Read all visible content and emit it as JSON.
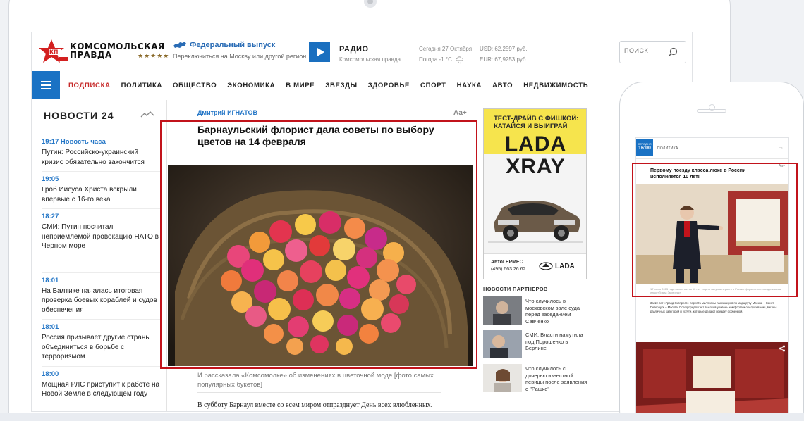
{
  "logo": {
    "line1": "КОМСОМОЛЬСКАЯ",
    "line2": "ПРАВДА",
    "orders": "★★★★★"
  },
  "edition": {
    "title": "Федеральный выпуск",
    "subtitle": "Переключиться на Москву или другой регион"
  },
  "radio": {
    "title": "РАДИО",
    "subtitle": "Комсомольская правда"
  },
  "date": {
    "today": "Сегодня 27 Октября",
    "weather": "Погода -1 °С"
  },
  "rates": {
    "usd": "USD: 62,2597 руб.",
    "eur": "EUR: 67,9253 руб."
  },
  "search": {
    "placeholder": "ПОИСК"
  },
  "nav": {
    "items": [
      {
        "label": "ПОДПИСКА",
        "active": true
      },
      {
        "label": "ПОЛИТИКА"
      },
      {
        "label": "ОБЩЕСТВО"
      },
      {
        "label": "ЭКОНОМИКА"
      },
      {
        "label": "В МИРЕ"
      },
      {
        "label": "ЗВЕЗДЫ"
      },
      {
        "label": "ЗДОРОВЬЕ"
      },
      {
        "label": "СПОРТ"
      },
      {
        "label": "НАУКА"
      },
      {
        "label": "АВТО"
      },
      {
        "label": "НЕДВИЖИМОСТЬ"
      }
    ]
  },
  "news24": {
    "title": "НОВОСТИ 24",
    "items": [
      {
        "time": "19:17 Новость часа",
        "title": "Путин: Российско-украинский кризис обязательно закончится"
      },
      {
        "time": "19:05",
        "title": "Гроб Иисуса Христа вскрыли впервые с 16-го века"
      },
      {
        "time": "18:27",
        "title": "СМИ: Путин посчитал неприемлемой провокацию НАТО в Черном море"
      },
      {
        "time": "18:01",
        "title": "На Балтике началась итоговая проверка боевых кораблей и судов обеспечения"
      },
      {
        "time": "18:01",
        "title": "Россия призывает другие страны объединиться в борьбе с терроризмом"
      },
      {
        "time": "18:00",
        "title": "Мощная РЛС приступит к работе на Новой Земле в следующем году"
      }
    ]
  },
  "article": {
    "author": "Дмитрий ИГНАТОВ",
    "font_toggle": "Аа+",
    "headline": "Барнаульский флорист дала советы по выбору цветов на 14 февраля",
    "caption": "И рассказала «Комсомолке» об изменениях в цветочной моде [фото самых популярных букетов]",
    "lead": "В субботу Барнаул вместе со всем миром отпразднует День всех влюбленных."
  },
  "ad": {
    "tagline_1": "ТЕСТ-ДРАЙВ С ФИШКОЙ:",
    "tagline_2": "КАТАЙСЯ И ВЫИГРАЙ",
    "brand": "LADA",
    "model": "XRAY",
    "dealer": "АвтоГЕРМЕС",
    "phone": "(495) 663 26 62",
    "logo": "LADA"
  },
  "partners": {
    "title": "НОВОСТИ ПАРТНЕРОВ",
    "items": [
      {
        "text": "Что случилось в московском зале суда перед заседанием Савченко"
      },
      {
        "text": "СМИ: Власти намутила под Порошенко в Берлине"
      },
      {
        "text": "Что случилось с дочерью известной певицы после заявления о \"Рашке\""
      }
    ]
  },
  "phone": {
    "time_label": "СЕГОДНЯ",
    "time": "16:00",
    "section": "ПОЛИТИКА",
    "font_toggle": "Аа+",
    "title": "Первому поезду класса люкс в России исполняется 10 лет!",
    "photo_caption": "17 июня 2015 года исполняется 10 лет со дня запуска первого в России фирменного поезда класса люкс «Гранд Экспресс»",
    "body": "За 10 лет «Гранд Экспресс» перевёз миллионы пассажиров по маршруту Москва – Санкт-Петербург – Москва. Поезд предлагает высокий уровень комфорта и обслуживания, вагоны различных категорий и услуги, которые делают поездку особенной."
  },
  "colors": {
    "brand_red": "#c62828",
    "link_blue": "#2577c7",
    "accent_blue": "#1a72c4",
    "highlight": "#c2131b"
  }
}
